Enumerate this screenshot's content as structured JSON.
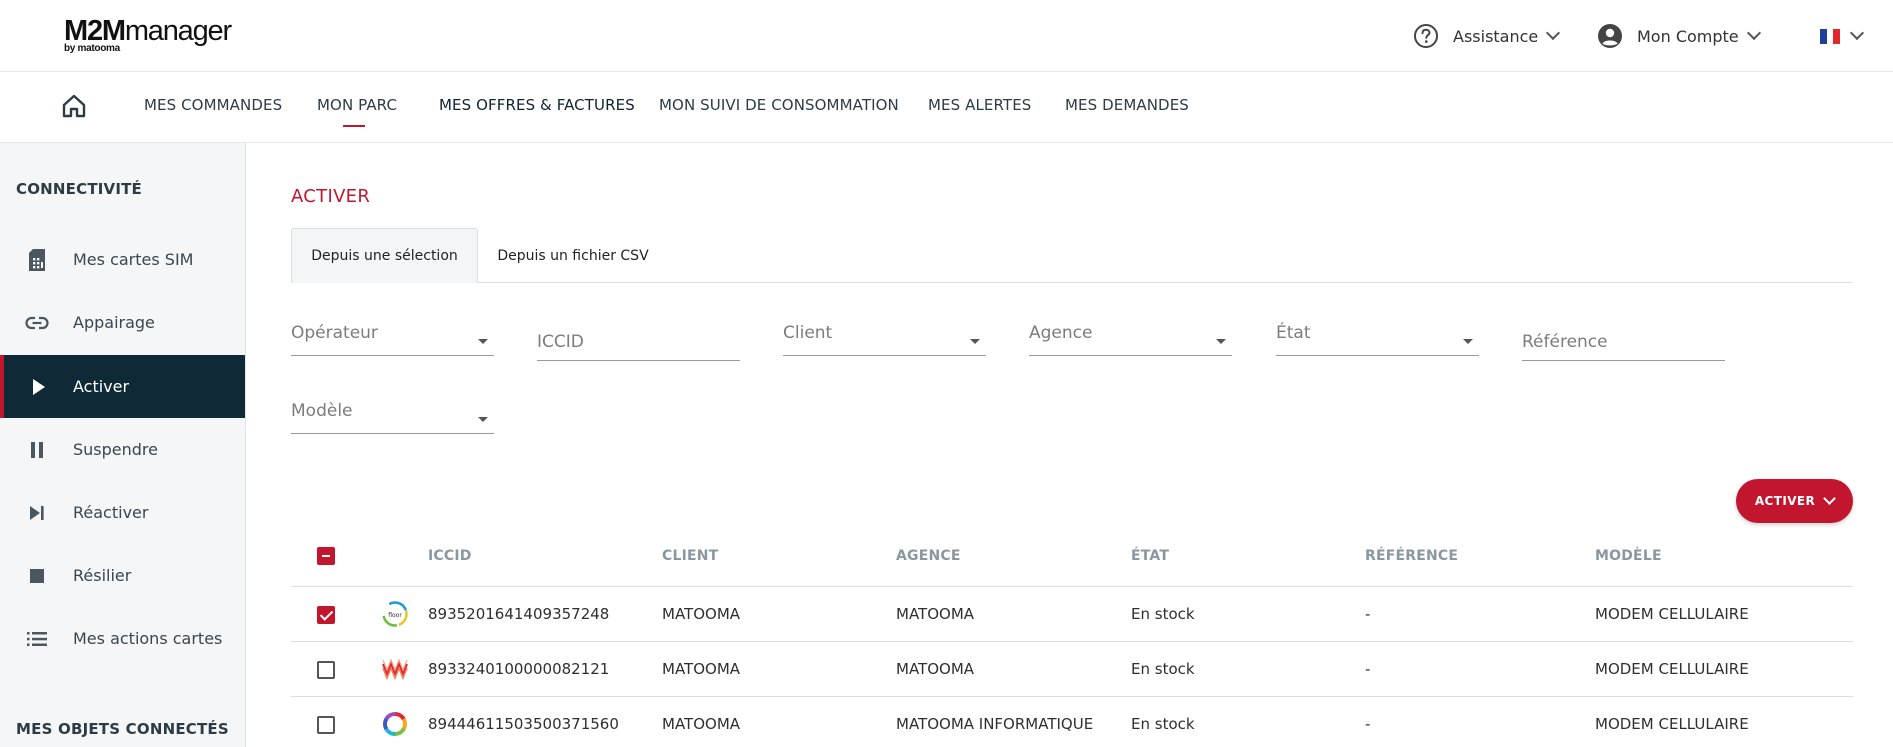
{
  "header": {
    "logo_main_bold": "M2M",
    "logo_main_rest": "manager",
    "logo_sub": "by matooma",
    "assistance_label": "Assistance",
    "account_label": "Mon Compte",
    "language_flag": "fr-flag-icon"
  },
  "nav": {
    "items": [
      {
        "label": "MES COMMANDES"
      },
      {
        "label": "MON PARC",
        "active": true
      },
      {
        "label": "MES OFFRES & FACTURES"
      },
      {
        "label": "MON SUIVI DE CONSOMMATION"
      },
      {
        "label": "MES ALERTES"
      },
      {
        "label": "MES DEMANDES"
      }
    ]
  },
  "sidebar": {
    "section1_title": "CONNECTIVITÉ",
    "items": [
      {
        "label": "Mes cartes SIM",
        "icon": "sim-card-icon"
      },
      {
        "label": "Appairage",
        "icon": "link-icon"
      },
      {
        "label": "Activer",
        "icon": "play-icon",
        "active": true
      },
      {
        "label": "Suspendre",
        "icon": "pause-icon"
      },
      {
        "label": "Réactiver",
        "icon": "skip-next-icon"
      },
      {
        "label": "Résilier",
        "icon": "stop-icon"
      },
      {
        "label": "Mes actions cartes",
        "icon": "list-icon"
      }
    ],
    "section2_title": "MES OBJETS CONNECTÉS"
  },
  "main": {
    "title": "ACTIVER",
    "tabs": [
      {
        "label": "Depuis une sélection",
        "selected": true
      },
      {
        "label": "Depuis un fichier CSV"
      }
    ],
    "filters": {
      "operateur": "Opérateur",
      "iccid": "ICCID",
      "client": "Client",
      "agence": "Agence",
      "etat": "État",
      "reference": "Référence",
      "modele": "Modèle"
    },
    "action_button": "ACTIVER"
  },
  "table": {
    "headers": {
      "iccid": "ICCID",
      "client": "CLIENT",
      "agence": "AGENCE",
      "etat": "ÉTAT",
      "reference": "RÉFÉRENCE",
      "modele": "MODÈLE"
    },
    "rows": [
      {
        "checked": true,
        "operator_icon": "floor-operator-icon",
        "iccid": "8935201641409357248",
        "client": "MATOOMA",
        "agence": "MATOOMA",
        "etat": "En stock",
        "reference": "-",
        "modele": "MODEM CELLULAIRE"
      },
      {
        "checked": false,
        "operator_icon": "wave-operator-icon",
        "iccid": "8933240100000082121",
        "client": "MATOOMA",
        "agence": "MATOOMA",
        "etat": "En stock",
        "reference": "-",
        "modele": "MODEM CELLULAIRE"
      },
      {
        "checked": false,
        "operator_icon": "rainbow-ring-operator-icon",
        "iccid": "89444611503500371560",
        "client": "MATOOMA",
        "agence": "MATOOMA INFORMATIQUE",
        "etat": "En stock",
        "reference": "-",
        "modele": "MODEM CELLULAIRE"
      }
    ]
  },
  "colors": {
    "accent": "#c2162f",
    "sidebar_active_bg": "#0f2a36",
    "sidebar_bg": "#f5f6f7"
  }
}
